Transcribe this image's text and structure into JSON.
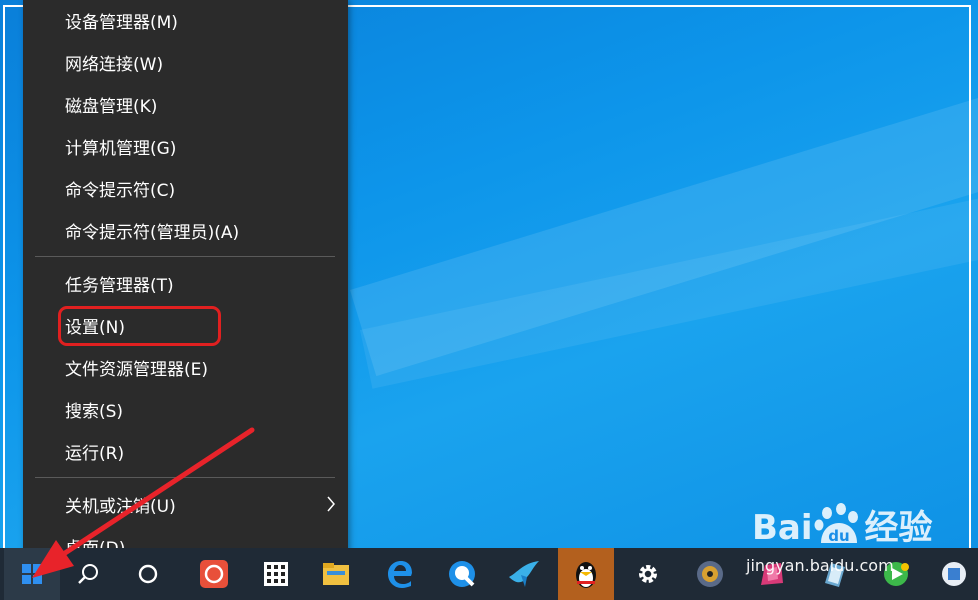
{
  "menu": {
    "items": [
      {
        "label": "设备管理器(M)"
      },
      {
        "label": "网络连接(W)"
      },
      {
        "label": "磁盘管理(K)"
      },
      {
        "label": "计算机管理(G)"
      },
      {
        "label": "命令提示符(C)"
      },
      {
        "label": "命令提示符(管理员)(A)"
      },
      {
        "label": "任务管理器(T)"
      },
      {
        "label": "设置(N)"
      },
      {
        "label": "文件资源管理器(E)"
      },
      {
        "label": "搜索(S)"
      },
      {
        "label": "运行(R)"
      },
      {
        "label": "关机或注销(U)"
      },
      {
        "label": "桌面(D)"
      }
    ]
  },
  "watermark": {
    "brand": "Bai",
    "brand_suffix": "du",
    "brand_cn": "经验",
    "url": "jingyan.baidu.com"
  },
  "colors": {
    "menu_bg": "#2b2b2b",
    "highlight": "#e02020",
    "desktop_blue": "#0d95ea",
    "taskbar": "#1f2a36"
  },
  "taskbar": {
    "icons": [
      "windows-start-icon",
      "search-icon",
      "cortana-icon",
      "app-red-icon",
      "app-grid-icon",
      "file-explorer-icon",
      "edge-icon",
      "browser-icon",
      "bird-app-icon",
      "qq-penguin-icon",
      "settings-gear-icon",
      "media-player-icon",
      "paint-icon",
      "tablet-icon",
      "video-player-icon",
      "store-icon"
    ]
  }
}
